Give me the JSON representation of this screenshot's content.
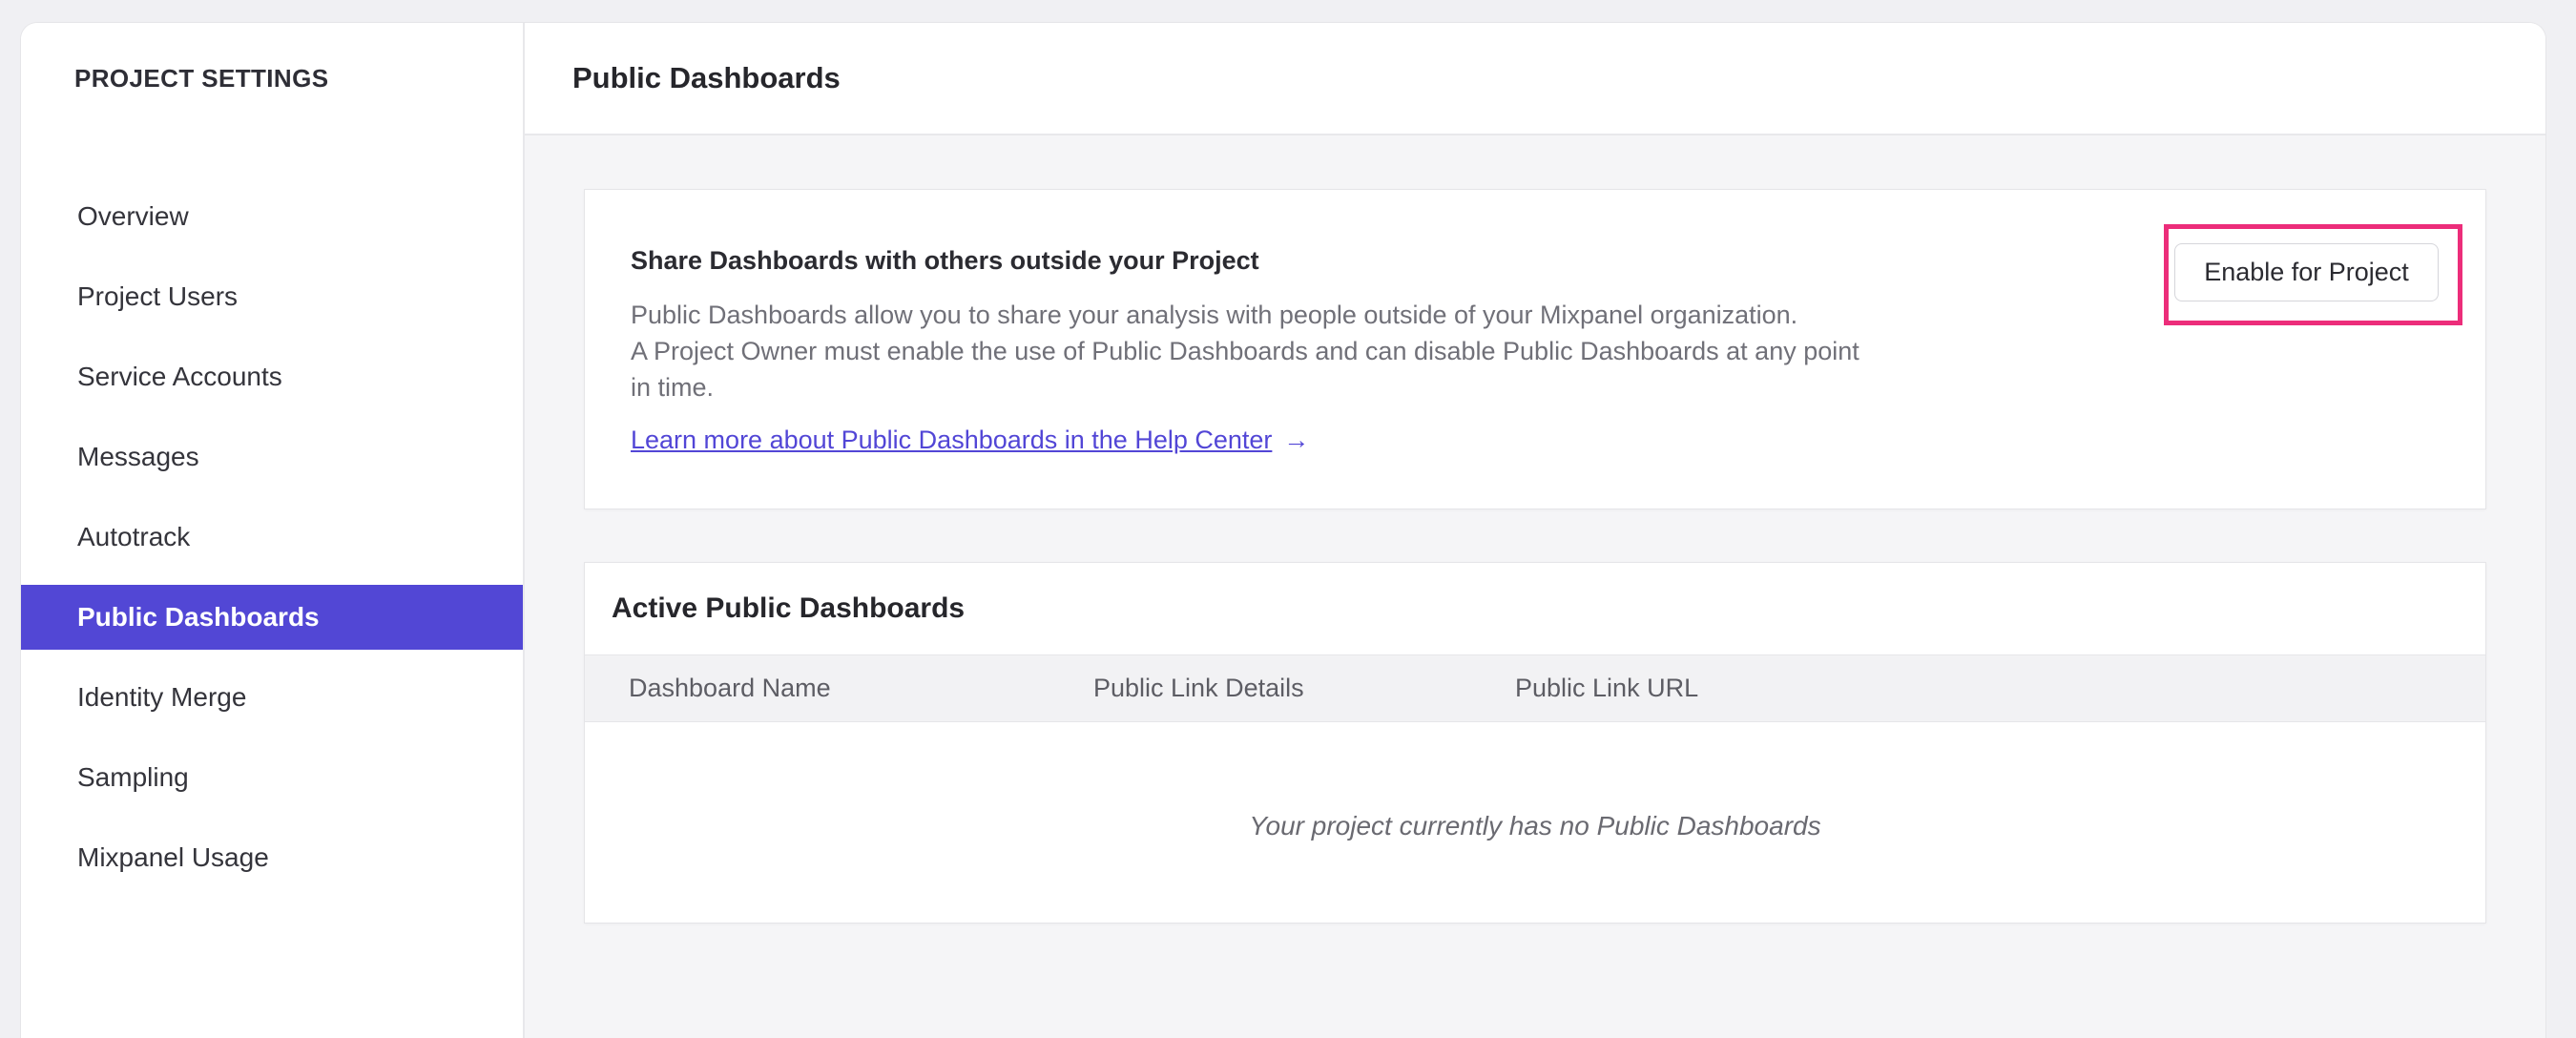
{
  "sidebar": {
    "title": "PROJECT SETTINGS",
    "selected_bg": "#5247d5",
    "items": [
      {
        "label": "Overview",
        "selected": false
      },
      {
        "label": "Project Users",
        "selected": false
      },
      {
        "label": "Service Accounts",
        "selected": false
      },
      {
        "label": "Messages",
        "selected": false
      },
      {
        "label": "Autotrack",
        "selected": false
      },
      {
        "label": "Public Dashboards",
        "selected": true
      },
      {
        "label": "Identity Merge",
        "selected": false
      },
      {
        "label": "Sampling",
        "selected": false
      },
      {
        "label": "Mixpanel Usage",
        "selected": false
      }
    ]
  },
  "header": {
    "title": "Public Dashboards"
  },
  "share_card": {
    "heading": "Share Dashboards with others outside your Project",
    "body_line_1": "Public Dashboards allow you to share your analysis with people outside of your Mixpanel organization.",
    "body_line_2": "A Project Owner must enable the use of Public Dashboards and can disable Public Dashboards at any point",
    "body_line_3": "in time.",
    "link_label": "Learn more about Public Dashboards in the Help Center",
    "link_arrow": "→",
    "button_label": "Enable for Project",
    "annotation_color": "#ec2d7a",
    "accent_color": "#5246d6"
  },
  "dashboards_card": {
    "title": "Active Public Dashboards",
    "columns": [
      "Dashboard Name",
      "Public Link Details",
      "Public Link URL"
    ],
    "rows": [],
    "empty_message": "Your project currently has no Public Dashboards"
  }
}
